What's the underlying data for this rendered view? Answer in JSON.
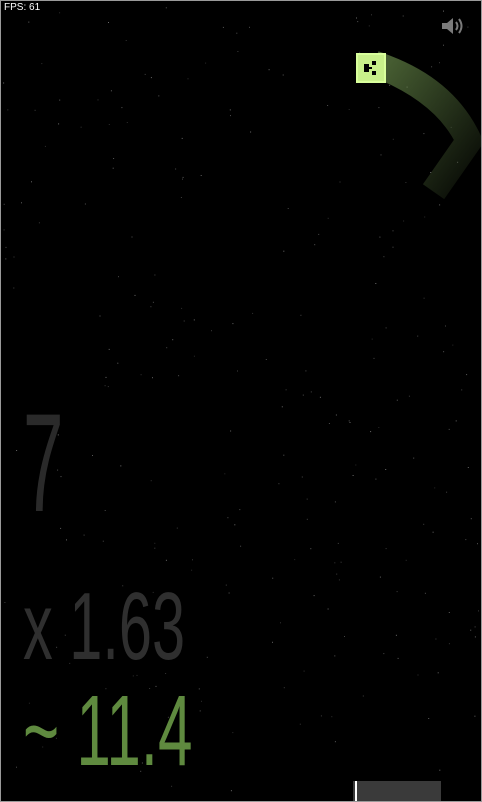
{
  "hud": {
    "fps_label": "FPS: 61"
  },
  "scores": {
    "score": "7",
    "multiplier": "x 1.63",
    "total": "~ 11.4"
  },
  "progress": {
    "fraction": 0.02
  },
  "icons": {
    "sound": "speaker-icon"
  },
  "colors": {
    "background": "#000000",
    "snake_head": "#c8f08a",
    "trail": "#7fa85a",
    "total_text": "#5f8a3f",
    "dim_text": "#2a2a2a"
  }
}
